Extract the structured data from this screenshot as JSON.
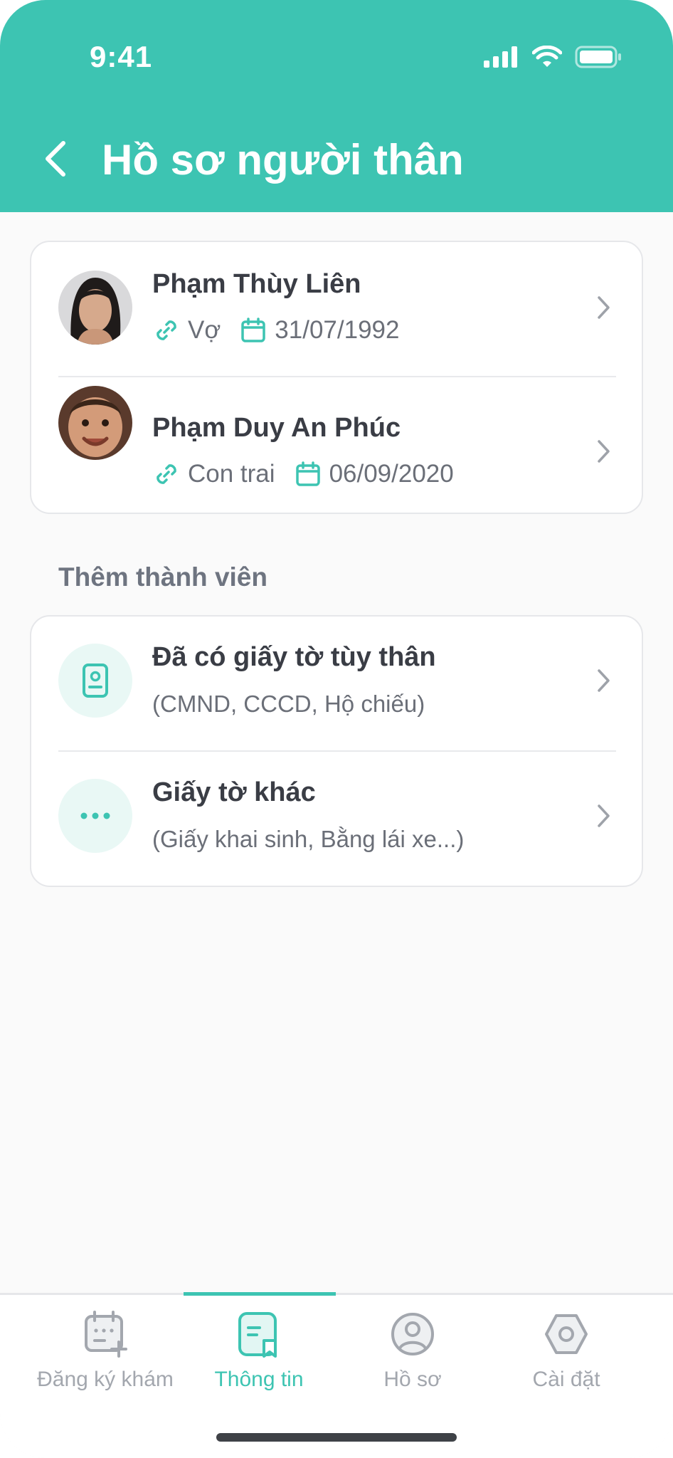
{
  "status_bar": {
    "time": "9:41"
  },
  "header": {
    "title": "Hồ sơ người thân"
  },
  "relatives": [
    {
      "name": "Phạm Thùy Liên",
      "relation": "Vợ",
      "birthdate": "31/07/1992"
    },
    {
      "name": "Phạm Duy An Phúc",
      "relation": "Con trai",
      "birthdate": "06/09/2020"
    }
  ],
  "add_section": {
    "label": "Thêm thành viên",
    "options": [
      {
        "title": "Đã có giấy tờ tùy thân",
        "subtitle": "(CMND, CCCD, Hộ chiếu)",
        "icon": "id-card-icon"
      },
      {
        "title": "Giấy tờ khác",
        "subtitle": "(Giấy khai sinh, Bằng lái xe...)",
        "icon": "more-dots-icon"
      }
    ]
  },
  "tabbar": {
    "tabs": [
      {
        "label": "Đăng ký khám",
        "icon": "calendar-add-icon",
        "active": false
      },
      {
        "label": "Thông tin",
        "icon": "document-icon",
        "active": true
      },
      {
        "label": "Hồ sơ",
        "icon": "user-circle-icon",
        "active": false
      },
      {
        "label": "Cài đặt",
        "icon": "settings-icon",
        "active": false
      }
    ]
  },
  "colors": {
    "accent": "#3dc4b2",
    "background": "#fafafa",
    "text": "#3a3d45",
    "muted": "#6b6f78"
  }
}
